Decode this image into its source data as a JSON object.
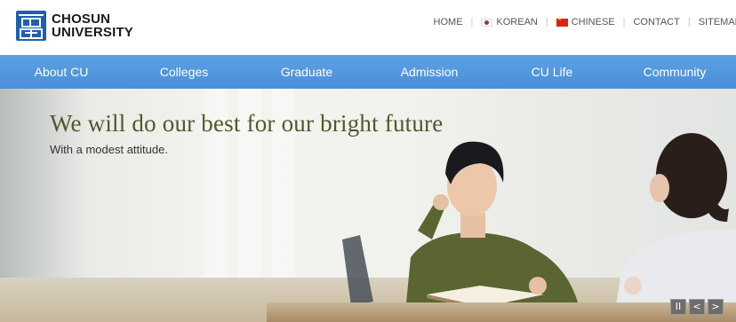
{
  "brand": {
    "line1": "CHOSUN",
    "line2": "UNIVERSITY",
    "seal_color": "#1f5fae"
  },
  "top_links": {
    "home": "HOME",
    "korean": "KOREAN",
    "chinese": "CHINESE",
    "contact": "CONTACT",
    "sitemap": "SITEMAP"
  },
  "nav": {
    "color": "#5599dd",
    "items": [
      "About CU",
      "Colleges",
      "Graduate",
      "Admission",
      "CU Life",
      "Community"
    ]
  },
  "hero": {
    "headline": "We will do our best for our bright future",
    "subline": "With a modest attitude."
  },
  "slider_controls": {
    "pause": "II",
    "prev": "<",
    "next": ">"
  }
}
